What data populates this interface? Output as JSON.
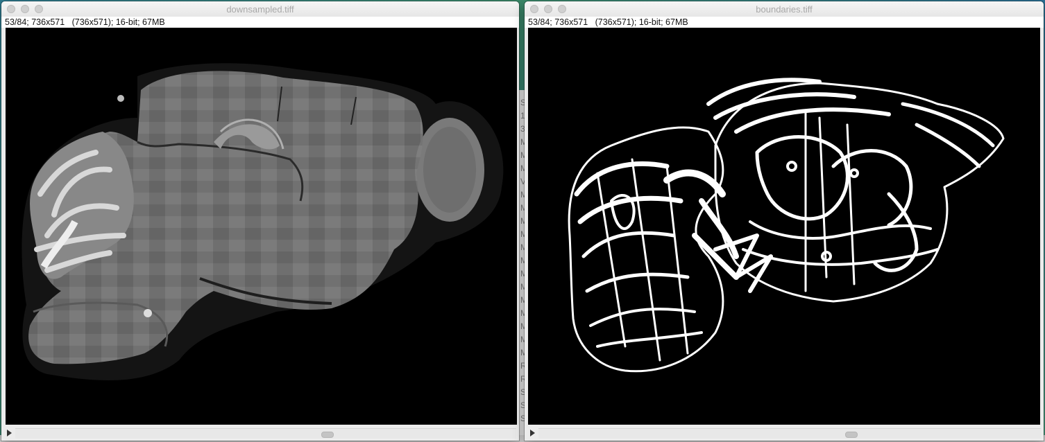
{
  "background_window": {
    "letters": [
      "S",
      "1",
      "3",
      "M",
      "M",
      "M",
      "V",
      "M",
      "M",
      "M",
      "M",
      "M",
      "M",
      "M",
      "M",
      "M",
      "M",
      "M",
      "M",
      "M",
      "R",
      "R",
      "S",
      "S",
      "S"
    ]
  },
  "windows": [
    {
      "title": "downsampled.tiff",
      "info": "53/84; 736x571   (736x571); 16-bit; 67MB",
      "image": "grayscale sagittal brain section",
      "slice_position": {
        "current": 53,
        "total": 84
      }
    },
    {
      "title": "boundaries.tiff",
      "info": "53/84; 736x571   (736x571); 16-bit; 67MB",
      "image": "white boundary outlines on black",
      "slice_position": {
        "current": 53,
        "total": 84
      }
    }
  ],
  "icons": {
    "play": "play-icon",
    "close": "close-button",
    "minimize": "minimize-button",
    "zoom": "zoom-button"
  },
  "colors": {
    "canvas_bg": "#000000",
    "boundary": "#ffffff",
    "tissue": "#6f6f6f",
    "window_chrome": "#ececec"
  }
}
